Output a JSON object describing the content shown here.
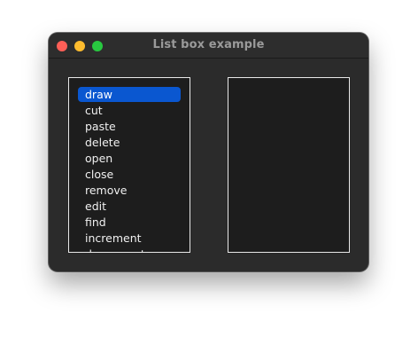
{
  "window": {
    "title": "List box example"
  },
  "listbox": {
    "selected_index": 0,
    "items": [
      "draw",
      "cut",
      "paste",
      "delete",
      "open",
      "close",
      "remove",
      "edit",
      "find",
      "increment",
      "decrement"
    ]
  },
  "colors": {
    "selection": "#0a57d0",
    "close": "#ff5f57",
    "minimize": "#febc2e",
    "maximize": "#28c840"
  }
}
